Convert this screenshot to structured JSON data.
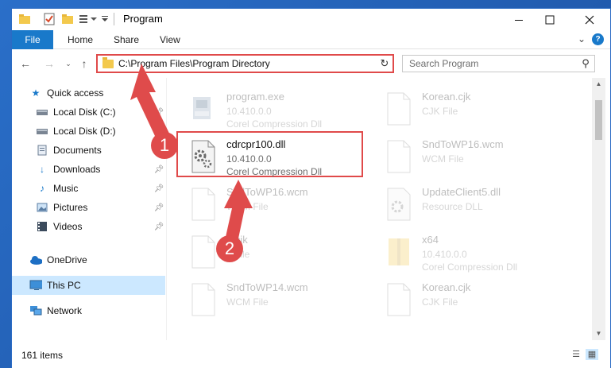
{
  "window": {
    "title": "Program"
  },
  "ribbon": {
    "tabs": [
      "File",
      "Home",
      "Share",
      "View"
    ]
  },
  "nav": {
    "address": "C:\\Program Files\\Program Directory",
    "search_placeholder": "Search Program"
  },
  "sidebar": {
    "items": [
      {
        "label": "Quick access",
        "icon": "star-icon"
      },
      {
        "label": "Local Disk (C:)",
        "icon": "drive-icon",
        "pinned": true
      },
      {
        "label": "Local Disk (D:)",
        "icon": "drive-icon",
        "pinned": true
      },
      {
        "label": "Documents",
        "icon": "documents-icon",
        "pinned": true
      },
      {
        "label": "Downloads",
        "icon": "download-icon",
        "pinned": true
      },
      {
        "label": "Music",
        "icon": "music-icon",
        "pinned": true
      },
      {
        "label": "Pictures",
        "icon": "pictures-icon",
        "pinned": true
      },
      {
        "label": "Videos",
        "icon": "videos-icon",
        "pinned": true
      },
      {
        "label": "OneDrive",
        "icon": "cloud-icon"
      },
      {
        "label": "This PC",
        "icon": "computer-icon",
        "selected": true
      },
      {
        "label": "Network",
        "icon": "network-icon"
      }
    ]
  },
  "files": [
    {
      "name": "program.exe",
      "l2": "10.410.0.0",
      "l3": "Corel Compression Dll",
      "faded": true
    },
    {
      "name": "Korean.cjk",
      "l2": "CJK File",
      "l3": "",
      "faded": true
    },
    {
      "name": "cdrcpr100.dll",
      "l2": "10.410.0.0",
      "l3": "Corel Compression Dll",
      "faded": false
    },
    {
      "name": "SndToWP16.wcm",
      "l2": "WCM File",
      "l3": "",
      "faded": true
    },
    {
      "name": "SndToWP16.wcm",
      "l2": "WCM File",
      "l3": "",
      "faded": true
    },
    {
      "name": "UpdateClient5.dll",
      "l2": "Resource DLL",
      "l3": "",
      "faded": true
    },
    {
      "name": "...cjk",
      "l2": "...File",
      "l3": "",
      "faded": true
    },
    {
      "name": "x64",
      "l2": "10.410.0.0",
      "l3": "Corel Compression Dll",
      "faded": true
    },
    {
      "name": "SndToWP14.wcm",
      "l2": "WCM File",
      "l3": "",
      "faded": true
    },
    {
      "name": "Korean.cjk",
      "l2": "CJK File",
      "l3": "",
      "faded": true
    }
  ],
  "status": {
    "item_count": "161 items"
  },
  "annotations": {
    "step1": "1",
    "step2": "2"
  },
  "colors": {
    "accent": "#1979ca",
    "highlight": "#e04a4a",
    "selected": "#cce8ff"
  }
}
